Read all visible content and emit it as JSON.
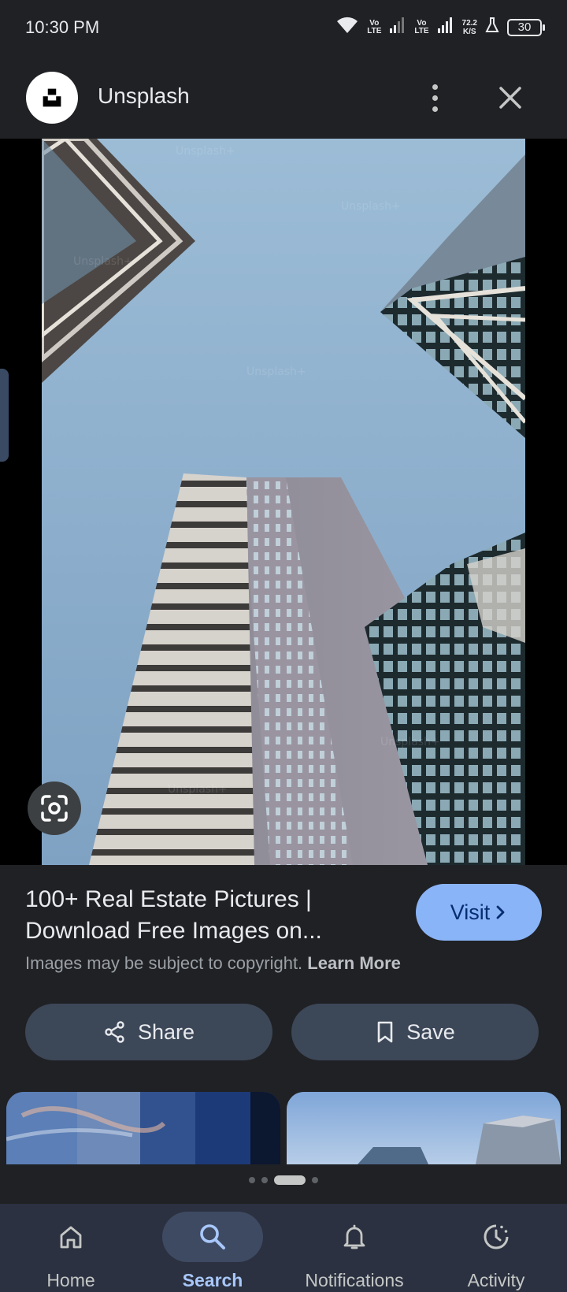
{
  "status_bar": {
    "time": "10:30 PM",
    "network1": "Vo LTE",
    "network2": "Vo LTE",
    "speed_value": "72.2",
    "speed_unit": "K/S",
    "battery": "30",
    "icons": [
      "wifi-icon",
      "signal-icon",
      "signal-icon",
      "flask-icon",
      "battery-icon"
    ]
  },
  "header": {
    "site_name": "Unsplash",
    "logo_icon": "unsplash-logo",
    "more_icon": "more-vert-icon",
    "close_icon": "close-icon"
  },
  "viewer": {
    "lens_icon": "google-lens-icon"
  },
  "result": {
    "title": "100+ Real Estate Pictures | Download Free Images on...",
    "visit_label": "Visit",
    "copyright_text": "Images may be subject to copyright.",
    "learn_more": "Learn More",
    "share_label": "Share",
    "save_label": "Save"
  },
  "pagination": {
    "count": 4,
    "active_index": 2
  },
  "bottom_nav": {
    "items": [
      {
        "label": "Home",
        "icon": "home-icon"
      },
      {
        "label": "Search",
        "icon": "search-icon",
        "active": true
      },
      {
        "label": "Notifications",
        "icon": "bell-icon"
      },
      {
        "label": "Activity",
        "icon": "activity-icon"
      }
    ]
  },
  "colors": {
    "background": "#202124",
    "accent": "#8ab4f8",
    "action_button": "#3c4758",
    "nav_background": "#2b3140"
  }
}
